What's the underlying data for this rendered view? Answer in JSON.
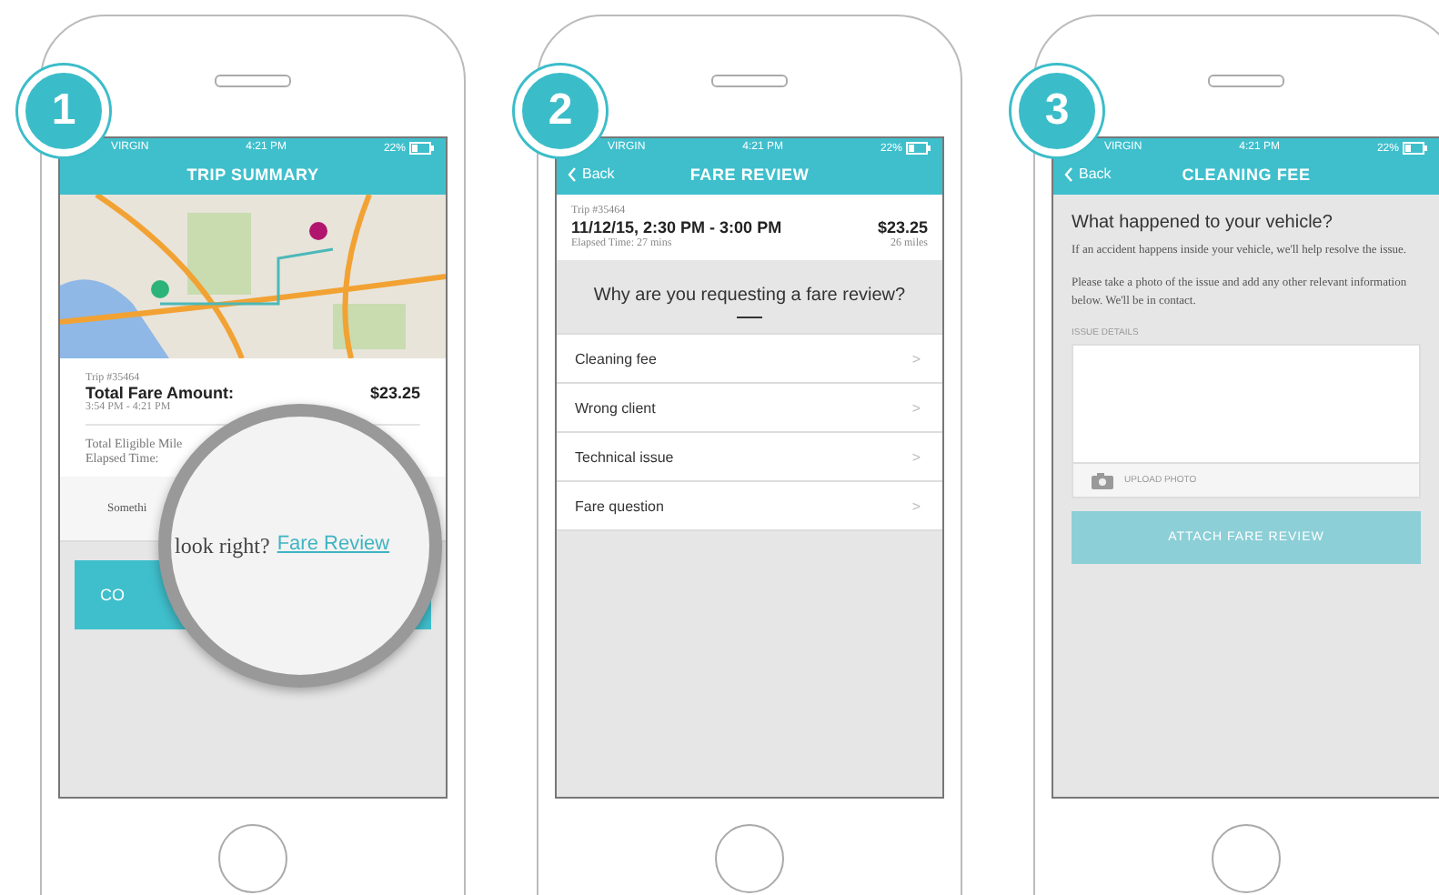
{
  "trip_summary": {
    "step": "1",
    "status": {
      "carrier": "VIRGIN",
      "time": "4:21 PM",
      "battery": "22%"
    },
    "title": "TRIP SUMMARY",
    "trip": {
      "number": "Trip #35464",
      "label": "Total Fare Amount:",
      "amount": "$23.25",
      "times": "3:54 PM - 4:21 PM",
      "mileage_label": "Total Eligible Mile",
      "elapsed_label": "Elapsed Time:"
    },
    "prompt": "Somethi",
    "button": "CO",
    "magnifier": {
      "text": "look right?",
      "link": "Fare Review"
    }
  },
  "fare_review": {
    "step": "2",
    "status": {
      "carrier": "VIRGIN",
      "time": "4:21 PM",
      "battery": "22%"
    },
    "back": "Back",
    "title": "FARE REVIEW",
    "trip": {
      "number": "Trip #35464",
      "dates": "11/12/15, 2:30 PM - 3:00 PM",
      "amount": "$23.25",
      "elapsed": "Elapsed Time: 27 mins",
      "miles": "26 miles"
    },
    "question": "Why are you requesting a fare review?",
    "reasons": [
      {
        "label": "Cleaning fee",
        "chevron": ">"
      },
      {
        "label": "Wrong client",
        "chevron": ">"
      },
      {
        "label": "Technical issue",
        "chevron": ">"
      },
      {
        "label": "Fare question",
        "chevron": ">"
      }
    ]
  },
  "cleaning_fee": {
    "step": "3",
    "status": {
      "carrier": "VIRGIN",
      "time": "4:21 PM",
      "battery": "22%"
    },
    "back": "Back",
    "title": "CLEANING FEE",
    "heading": "What happened to your vehicle?",
    "paragraphs": [
      "If an accident happens inside your vehicle, we'll help resolve the issue.",
      "Please take a photo of the issue and add any other relevant information below. We'll be in contact."
    ],
    "field_label": "ISSUE DETAILS",
    "upload": "UPLOAD PHOTO",
    "button": {
      "label": "ATTACH FARE REVIEW",
      "disabled": true
    }
  }
}
